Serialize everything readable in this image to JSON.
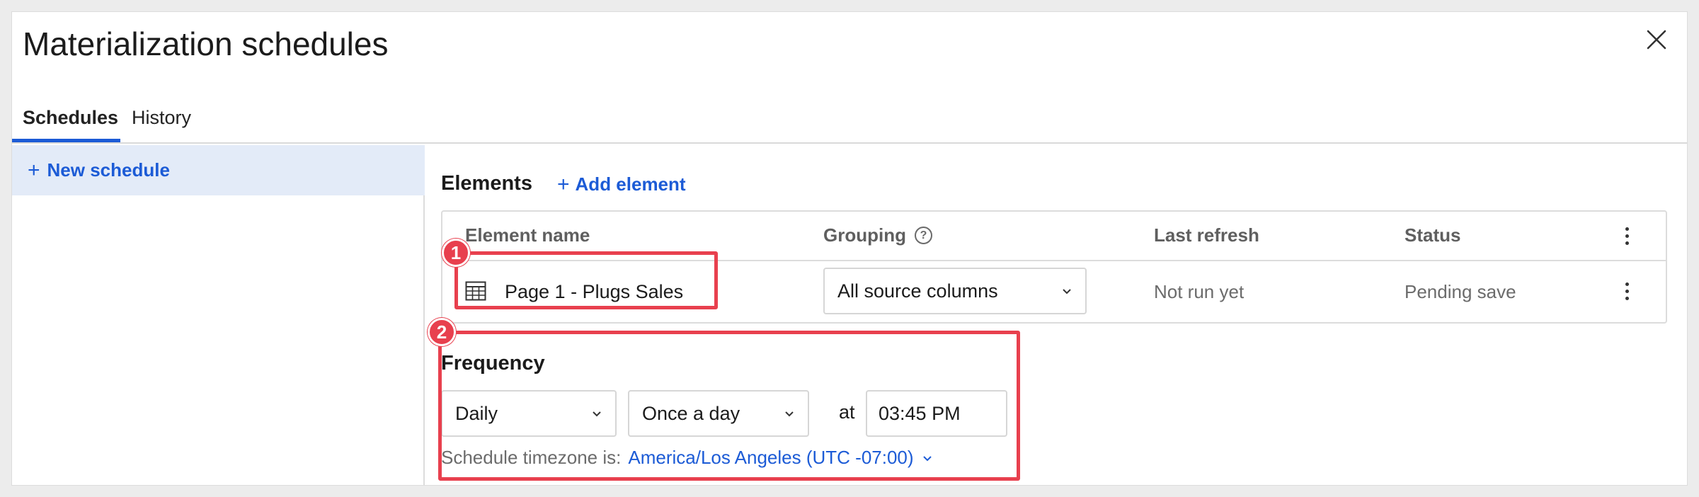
{
  "dialog": {
    "title": "Materialization schedules",
    "close_icon": "close-icon"
  },
  "tabs": [
    {
      "label": "Schedules",
      "active": true
    },
    {
      "label": "History",
      "active": false
    }
  ],
  "sidebar": {
    "new_schedule_label": "New schedule",
    "plus_icon": "plus-icon"
  },
  "elements": {
    "heading": "Elements",
    "add_label": "Add element",
    "columns": {
      "name": "Element name",
      "grouping": "Grouping",
      "last_refresh": "Last refresh",
      "status": "Status"
    },
    "rows": [
      {
        "name": "Page 1 - Plugs Sales",
        "icon": "table-icon",
        "grouping": "All source columns",
        "last_refresh": "Not run yet",
        "status": "Pending save"
      }
    ]
  },
  "frequency": {
    "heading": "Frequency",
    "period": "Daily",
    "repeat": "Once a day",
    "at_label": "at",
    "time": "03:45 PM",
    "timezone_label": "Schedule timezone is:",
    "timezone_value": "America/Los Angeles (UTC -07:00)"
  },
  "callouts": [
    {
      "number": "1"
    },
    {
      "number": "2"
    }
  ],
  "colors": {
    "accent": "#1c5bd6",
    "callout": "#e8404e",
    "selected_bg": "#e3ebf8"
  }
}
